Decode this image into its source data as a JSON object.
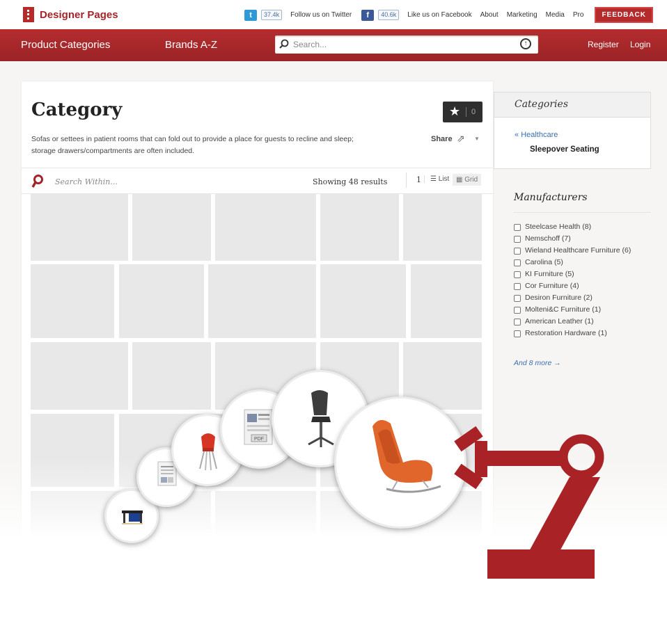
{
  "header": {
    "logo_text": "Designer Pages",
    "twitter_count": "37.4k",
    "twitter_label": "Follow us on Twitter",
    "facebook_count": "40.6k",
    "facebook_label": "Like us on Facebook",
    "links": [
      "About",
      "Marketing",
      "Media",
      "Pro"
    ],
    "feedback_label": "FEEDBACK"
  },
  "nav": {
    "product_categories": "Product Categories",
    "brands": "Brands A-Z",
    "search_placeholder": "Search...",
    "register": "Register",
    "login": "Login"
  },
  "category": {
    "title": "Category",
    "description": "Sofas or settees in patient rooms that can fold out to provide a place for guests to recline and sleep; storage drawers/compartments are often included.",
    "favorite_count": "0",
    "share_label": "Share"
  },
  "toolbar": {
    "search_within": "Search Within...",
    "results": "Showing 48 results",
    "page": "1",
    "list_label": "List",
    "grid_label": "Grid"
  },
  "sidebar": {
    "categories_title": "Categories",
    "parent_category": "Healthcare",
    "current_category": "Sleepover Seating",
    "manufacturers_title": "Manufacturers",
    "manufacturers": [
      "Steelcase Health (8)",
      "Nemschoff (7)",
      "Wieland Healthcare Furniture (6)",
      "Carolina (5)",
      "KI Furniture (5)",
      "Cor Furniture (4)",
      "Desiron Furniture (2)",
      "Molteni&C Furniture (1)",
      "American Leather (1)",
      "Restoration Hardware (1)"
    ],
    "more_label": "And 8 more →"
  },
  "colors": {
    "brand_red": "#a3252a",
    "nav_red": "#b52d2f",
    "link_blue": "#3a6fb0",
    "tile_gray": "#e8e8e8"
  }
}
